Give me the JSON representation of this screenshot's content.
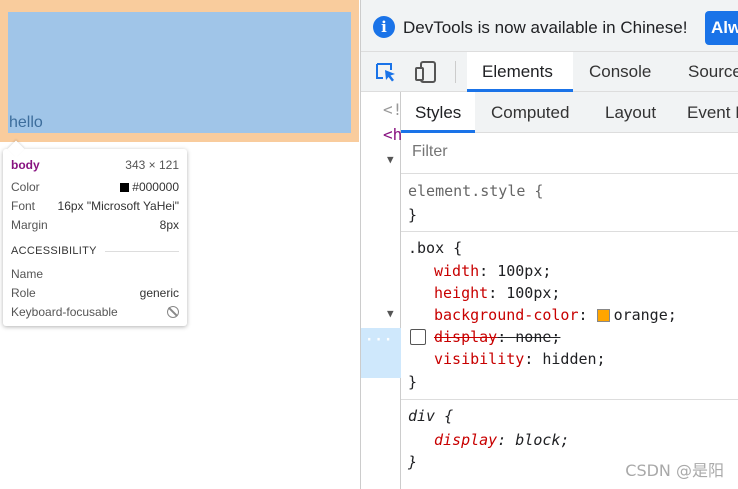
{
  "page": {
    "hello_text": "hello"
  },
  "tooltip": {
    "tag": "body",
    "dimensions": "343 × 121",
    "rows": [
      {
        "key": "Color",
        "value": "#000000"
      },
      {
        "key": "Font",
        "value": "16px \"Microsoft YaHei\""
      },
      {
        "key": "Margin",
        "value": "8px"
      }
    ],
    "section": "ACCESSIBILITY",
    "a11y": [
      {
        "key": "Name",
        "value": ""
      },
      {
        "key": "Role",
        "value": "generic"
      },
      {
        "key": "Keyboard-focusable",
        "value": ""
      }
    ],
    "swatch_color": "#000000"
  },
  "infobar": {
    "icon": "info-icon",
    "message": "DevTools is now available in Chinese!",
    "button": "Alw"
  },
  "toolbar": {
    "tabs": [
      "Elements",
      "Console",
      "Source"
    ],
    "active": "Elements"
  },
  "dom": {
    "fragments": [
      "<!",
      "<h"
    ]
  },
  "styles": {
    "subtabs": [
      "Styles",
      "Computed",
      "Layout",
      "Event L"
    ],
    "active": "Styles",
    "filter_placeholder": "Filter",
    "rules": {
      "element_style": {
        "selector": "element.style {",
        "close": "}"
      },
      "box": {
        "selector": ".box {",
        "decls": [
          {
            "prop": "width",
            "value": "100px;"
          },
          {
            "prop": "height",
            "value": "100px;"
          },
          {
            "prop": "background-color",
            "value": "orange;",
            "swatch": "#ffa500"
          },
          {
            "prop": "display",
            "value": "none;",
            "disabled": true
          },
          {
            "prop": "visibility",
            "value": "hidden;"
          }
        ],
        "close": "}"
      },
      "div": {
        "selector": "div {",
        "decls": [
          {
            "prop": "display",
            "value": "block;"
          }
        ],
        "close": "}"
      }
    }
  },
  "colors": {
    "accent": "#1a73e8",
    "margin_highlight": "#f9cc9d",
    "content_highlight": "#a0c5e8",
    "selected_row": "#cfe8fc"
  },
  "watermark": "CSDN @是阳"
}
